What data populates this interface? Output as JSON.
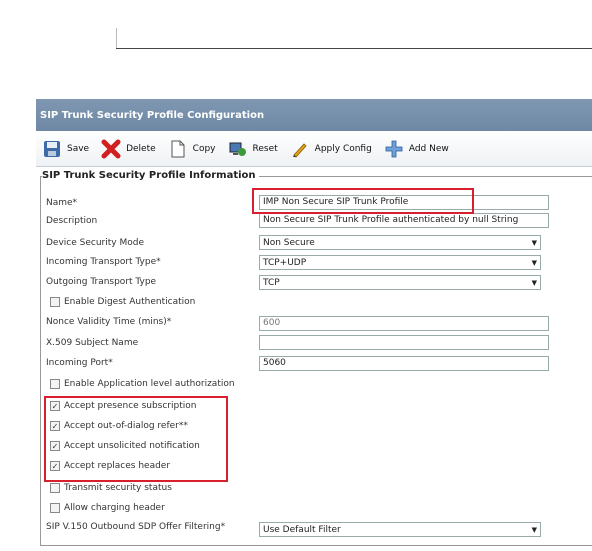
{
  "page_header": {
    "title": "SIP Trunk Security Profile Configuration"
  },
  "toolbar": {
    "save": "Save",
    "delete": "Delete",
    "copy": "Copy",
    "reset": "Reset",
    "apply_config": "Apply Config",
    "add_new": "Add New"
  },
  "section": {
    "title": "SIP Trunk Security Profile Information"
  },
  "fields": {
    "name": {
      "label": "Name*",
      "value": "IMP Non Secure SIP Trunk Profile"
    },
    "description": {
      "label": "Description",
      "value": "Non Secure SIP Trunk Profile authenticated by null String"
    },
    "device_security_mode": {
      "label": "Device Security Mode",
      "value": "Non Secure"
    },
    "incoming_transport_type": {
      "label": "Incoming Transport Type*",
      "value": "TCP+UDP"
    },
    "outgoing_transport_type": {
      "label": "Outgoing Transport Type",
      "value": "TCP"
    },
    "enable_digest_auth": {
      "label": "Enable Digest Authentication",
      "checked": false
    },
    "nonce_validity_time": {
      "label": "Nonce Validity Time (mins)*",
      "value": "600"
    },
    "x509_subject_name": {
      "label": "X.509 Subject Name",
      "value": ""
    },
    "incoming_port": {
      "label": "Incoming Port*",
      "value": "5060"
    },
    "enable_app_level_auth": {
      "label": "Enable Application level authorization",
      "checked": false
    },
    "accept_presence_subscription": {
      "label": "Accept presence subscription",
      "checked": true
    },
    "accept_out_of_dialog_refer": {
      "label": "Accept out-of-dialog refer**",
      "checked": true
    },
    "accept_unsolicited_notification": {
      "label": "Accept unsolicited notification",
      "checked": true
    },
    "accept_replaces_header": {
      "label": "Accept replaces header",
      "checked": true
    },
    "transmit_security_status": {
      "label": "Transmit security status",
      "checked": false
    },
    "allow_charging_header": {
      "label": "Allow charging header",
      "checked": false
    },
    "sdp_offer_filtering": {
      "label": "SIP V.150 Outbound SDP Offer Filtering*",
      "value": "Use Default Filter"
    }
  },
  "colors": {
    "header_bg": "#7489a4",
    "highlight": "#d62030"
  }
}
